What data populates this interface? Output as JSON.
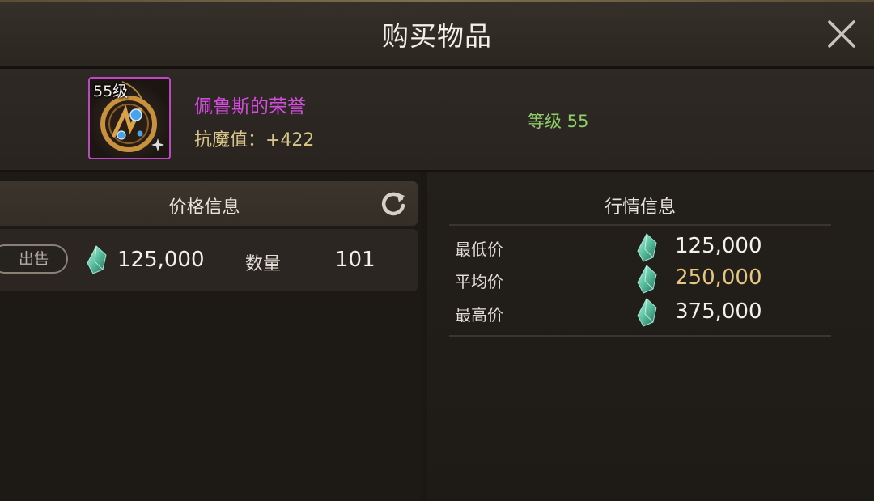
{
  "header": {
    "title": "购买物品",
    "close_icon": "close-icon"
  },
  "item": {
    "level_tag": "55级",
    "name": "佩鲁斯的荣誉",
    "stat": "抗魔值：+422",
    "grade": "等级 55",
    "name_color": "#d64be0",
    "border_color": "#c244c7",
    "icon": "amulet-icon"
  },
  "price_panel": {
    "header": "价格信息",
    "refresh_icon": "refresh-icon",
    "sell_label": "出售",
    "currency_icon": "gem-icon",
    "price": "125,000",
    "quantity_label": "数量",
    "quantity": "101"
  },
  "market_panel": {
    "header": "行情信息",
    "rows": [
      {
        "label": "最低价",
        "value": "125,000",
        "color": "#f4f1ec"
      },
      {
        "label": "平均价",
        "value": "250,000",
        "color": "#e6c580"
      },
      {
        "label": "最高价",
        "value": "375,000",
        "color": "#f4f1ec"
      }
    ]
  }
}
